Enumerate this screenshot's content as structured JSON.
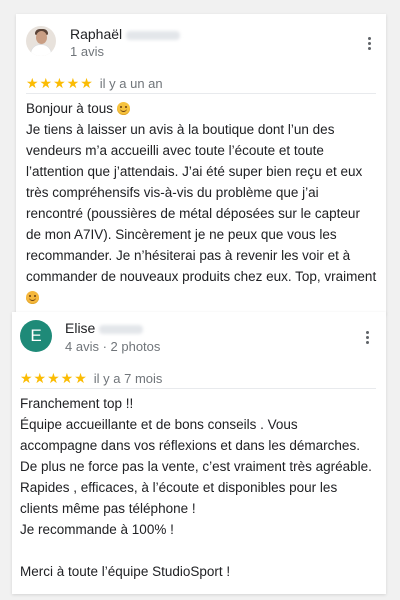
{
  "reviews": [
    {
      "avatar_type": "photo",
      "author": "Raphaël",
      "meta": "1 avis",
      "stars": "★★★★★",
      "rating": 5,
      "time": "il y a un an",
      "lines": [
        "Bonjour à tous",
        "Je tiens à laisser un avis à la boutique dont l’un des vendeurs m’a accueilli avec toute l’écoute et toute l’attention que j’attendais. J’ai été super bien reçu et eux très compréhensifs vis-à-vis du problème que j’ai rencontré (poussières de métal déposées sur le capteur de mon A7IV). Sincèrement je ne peux que vous les recommander. Je n’hésiterai pas à revenir les voir et à commander de nouveaux produits chez eux. Top, vraiment"
      ],
      "emojis": [
        "smiling-face-icon",
        "winking-face-icon"
      ]
    },
    {
      "avatar_type": "letter",
      "avatar_letter": "E",
      "avatar_color": "#1e8a78",
      "author": "Elise",
      "meta": "4 avis · 2 photos",
      "stars": "★★★★★",
      "rating": 5,
      "time": "il y a 7 mois",
      "lines": [
        "Franchement top !!",
        "Équipe accueillante et de bons conseils . Vous accompagne dans vos réflexions et dans les démarches. De plus ne force pas la vente, c’est vraiment très agréable. Rapides , efficaces, à l’écoute et disponibles pour les clients même pas téléphone !",
        "Je recommande à 100% !",
        "",
        "Merci à toute l’équipe StudioSport !"
      ]
    }
  ],
  "colors": {
    "star": "#fbbc04",
    "meta_text": "#70757a",
    "background": "#f1f1f1"
  },
  "icons": [
    "more-vert-icon",
    "star-icon"
  ]
}
